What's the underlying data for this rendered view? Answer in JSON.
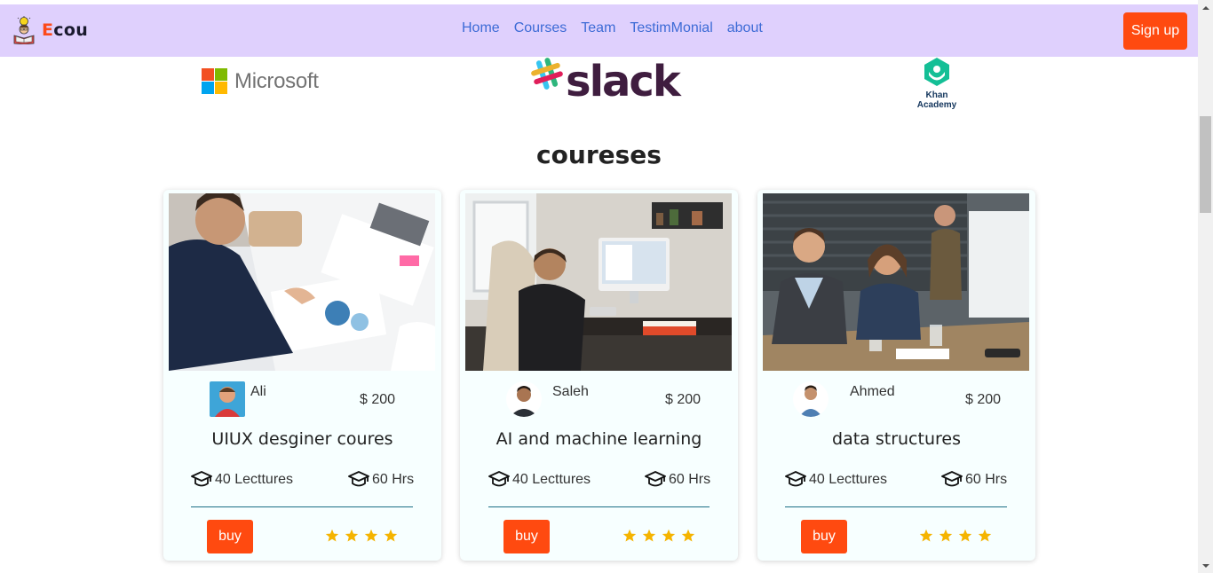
{
  "brand": {
    "first_letter": "E",
    "rest": "cou",
    "accent": "#fc4a1a"
  },
  "nav": {
    "links": [
      "Home",
      "Courses",
      "Team",
      "TestimMonial",
      "about"
    ],
    "signup_label": "Sign up",
    "bg_color": "#dfd0fd",
    "link_color": "#3d6bd6"
  },
  "partners": {
    "microsoft": "Microsoft",
    "slack": "slack",
    "khan_line1": "Khan",
    "khan_line2": "Academy"
  },
  "section": {
    "title": "coureses"
  },
  "courses": [
    {
      "instructor": "Ali",
      "price": "$ 200",
      "title": "UIUX desginer coures",
      "lectures": "40 Lecttures",
      "hours": "60 Hrs",
      "buy_label": "buy",
      "rating": 4
    },
    {
      "instructor": "Saleh",
      "price": "$ 200",
      "title": "AI and machine learning",
      "lectures": "40 Lecttures",
      "hours": "60 Hrs",
      "buy_label": "buy",
      "rating": 4
    },
    {
      "instructor": "Ahmed",
      "price": "$ 200",
      "title": "data structures",
      "lectures": "40 Lecttures",
      "hours": "60 Hrs",
      "buy_label": "buy",
      "rating": 4
    }
  ],
  "icons": {
    "brand": "book-reader-icon",
    "lectures": "graduation-cap-icon",
    "hours": "graduation-cap-icon",
    "rating": "star-icon"
  },
  "colors": {
    "button": "#ff4a10",
    "star": "#f5b400",
    "divider": "#1b6f86"
  }
}
